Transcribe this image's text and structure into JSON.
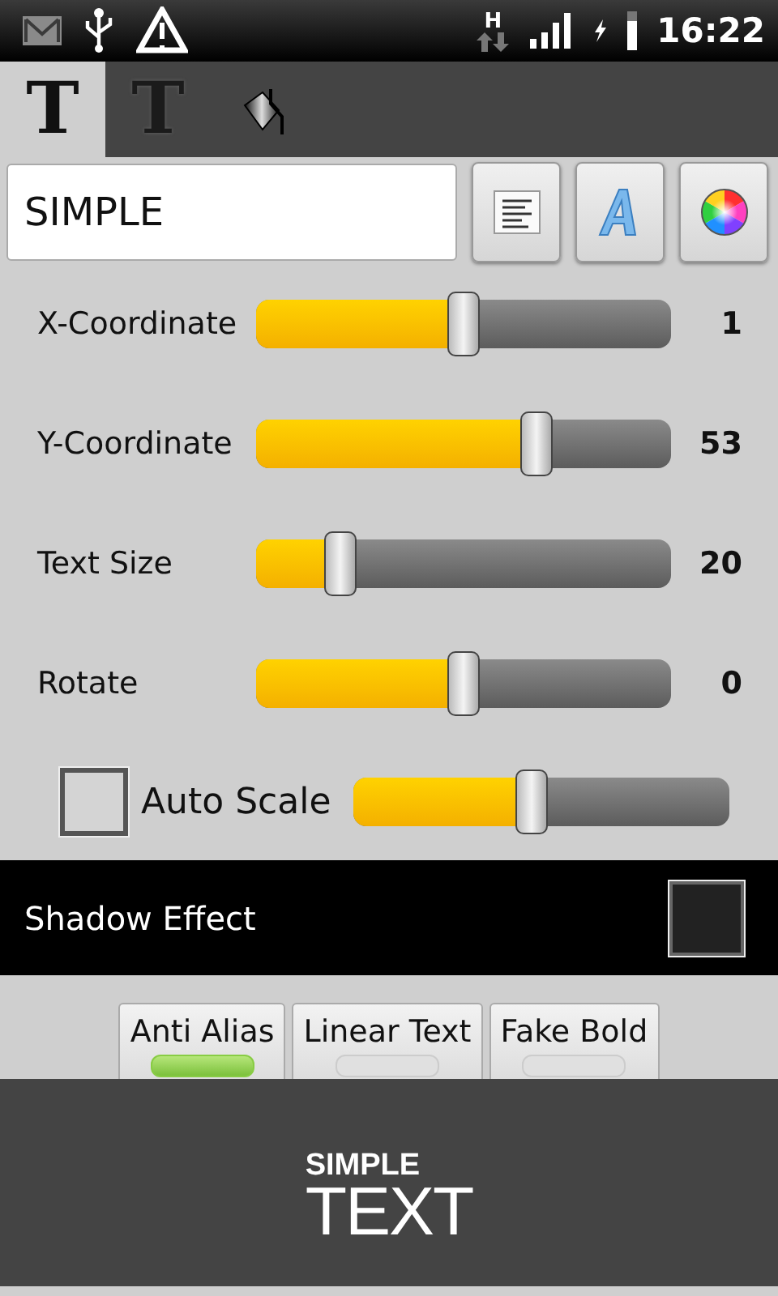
{
  "status_bar": {
    "network_type": "H",
    "time": "16:22"
  },
  "tabs": [
    {
      "kind": "letter",
      "label": "T",
      "selected": true
    },
    {
      "kind": "shaded-letter",
      "label": "T",
      "selected": false
    },
    {
      "kind": "bucket",
      "selected": false
    }
  ],
  "text_field": {
    "value": "SIMPLE"
  },
  "tool_buttons": [
    {
      "kind": "align"
    },
    {
      "kind": "font"
    },
    {
      "kind": "color"
    }
  ],
  "sliders": [
    {
      "label": "X-Coordinate",
      "level": 0.5,
      "reading": "1"
    },
    {
      "label": "Y-Coordinate",
      "level": 0.69,
      "reading": "53"
    },
    {
      "label": "Text Size",
      "level": 0.18,
      "reading": "20"
    },
    {
      "label": "Rotate",
      "level": 0.5,
      "reading": "0"
    }
  ],
  "auto_scale": {
    "label": "Auto Scale",
    "checked": false,
    "level": 0.47
  },
  "shadow_effect": {
    "label": "Shadow Effect",
    "checked": false
  },
  "toggles": [
    {
      "label": "Anti Alias",
      "on": true
    },
    {
      "label": "Linear Text",
      "on": false
    },
    {
      "label": "Fake Bold",
      "on": false
    }
  ],
  "logo": {
    "top": "SIMPLE",
    "bottom": "TEXT"
  }
}
